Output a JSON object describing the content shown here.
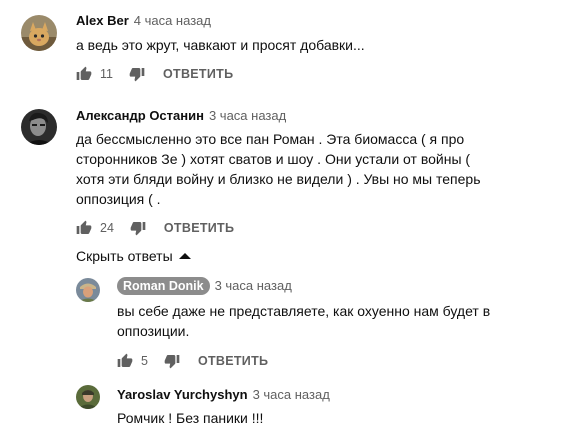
{
  "comments": [
    {
      "author": "Alex Ber",
      "time": "4 часа назад",
      "text": "а ведь это жрут, чавкают и просят добавки...",
      "likes": "11",
      "reply_label": "ОТВЕТИТЬ"
    },
    {
      "author": "Александр Останин",
      "time": "3 часа назад",
      "text": "да бессмысленно это все пан Роман . Эта биомасса ( я про сторонников Зе ) хотят сватов и шоу . Они устали от войны ( хотя эти бляди войну и близко не видели ) . Увы но мы теперь оппозиция ( .",
      "likes": "24",
      "reply_label": "ОТВЕТИТЬ"
    }
  ],
  "hide_replies_label": "Скрыть ответы",
  "replies": [
    {
      "author": "Roman Donik",
      "time": "3 часа назад",
      "text": "вы себе даже не представляете, как охуенно нам будет в оппозиции.",
      "likes": "5",
      "reply_label": "ОТВЕТИТЬ"
    },
    {
      "author": "Yaroslav Yurchyshyn",
      "time": "3 часа назад",
      "text": "Ромчик ! Без паники !!!"
    }
  ],
  "colors": {
    "text": "#0f0f0f",
    "secondary": "#606060",
    "icon": "#606060",
    "badge_bg": "#8c8c8c"
  }
}
